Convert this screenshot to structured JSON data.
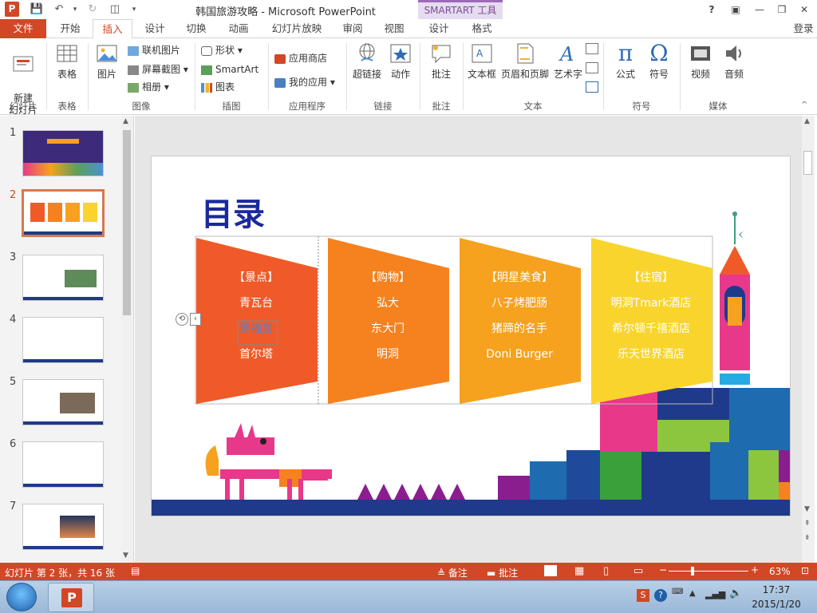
{
  "window": {
    "title": "韩国旅游攻略 - Microsoft PowerPoint",
    "contextual_tab_group": "SMARTART 工具",
    "help_label": "?",
    "signin_label": "登录"
  },
  "tabs": [
    "文件",
    "开始",
    "插入",
    "设计",
    "切换",
    "动画",
    "幻灯片放映",
    "审阅",
    "视图",
    "设计",
    "格式"
  ],
  "ribbon": {
    "groups": {
      "slides": {
        "label": "幻灯片",
        "new_slide": "新建\n幻灯片"
      },
      "tables": {
        "label": "表格",
        "table": "表格"
      },
      "images": {
        "label": "图像",
        "picture": "图片",
        "online_pictures": "联机图片",
        "screenshot": "屏幕截图",
        "album": "相册"
      },
      "illustrations": {
        "label": "插图",
        "shapes": "形状",
        "smartart": "SmartArt",
        "chart": "图表"
      },
      "apps": {
        "label": "应用程序",
        "store": "应用商店",
        "my_apps": "我的应用"
      },
      "links": {
        "label": "链接",
        "hyperlink": "超链接",
        "action": "动作"
      },
      "comments": {
        "label": "批注",
        "comment": "批注"
      },
      "text": {
        "label": "文本",
        "textbox": "文本框",
        "header_footer": "页眉和页脚",
        "wordart": "艺术字"
      },
      "symbols": {
        "label": "符号",
        "equation": "公式",
        "symbol": "符号"
      },
      "media": {
        "label": "媒体",
        "video": "视频",
        "audio": "音频"
      }
    }
  },
  "thumbnails": {
    "numbers": [
      "1",
      "2",
      "3",
      "4",
      "5",
      "6",
      "7"
    ],
    "selected_index": 1
  },
  "slide": {
    "title": "目录",
    "columns": [
      {
        "heading": "【景点】",
        "items": [
          "青瓦台",
          "景福宫",
          "首尔塔"
        ],
        "color": "#f05a28"
      },
      {
        "heading": "【购物】",
        "items": [
          "弘大",
          "东大门",
          "明洞"
        ],
        "color": "#f5821f"
      },
      {
        "heading": "【明星美食】",
        "items": [
          "八子烤肥肠",
          "猪蹄的名手",
          "Doni Burger"
        ],
        "color": "#f6a21e"
      },
      {
        "heading": "【住宿】",
        "items": [
          "明洞Tmark酒店",
          "希尔顿千禧酒店",
          "乐天世界酒店"
        ],
        "color": "#f9d42c"
      }
    ]
  },
  "status": {
    "slide_info": "幻灯片 第 2 张，共 16 张",
    "notes": "备注",
    "comments": "批注",
    "zoom": "63%"
  },
  "taskbar": {
    "time": "17:37",
    "date": "2015/1/20"
  },
  "colors": {
    "accent": "#d24726",
    "smartart": "#9c6ab7"
  }
}
